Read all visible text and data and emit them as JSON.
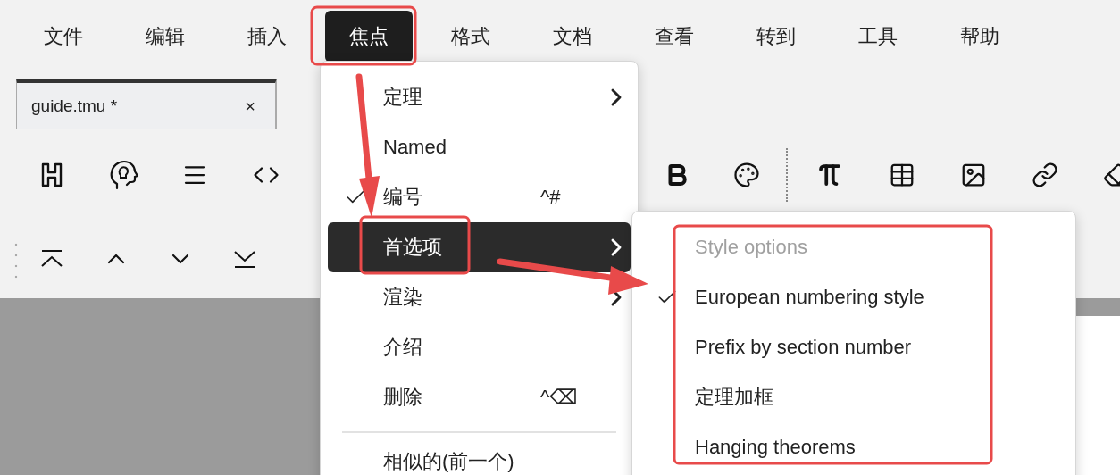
{
  "menubar": [
    {
      "label": "文件",
      "selected": false
    },
    {
      "label": "编辑",
      "selected": false
    },
    {
      "label": "插入",
      "selected": false
    },
    {
      "label": "焦点",
      "selected": true
    },
    {
      "label": "格式",
      "selected": false
    },
    {
      "label": "文档",
      "selected": false
    },
    {
      "label": "查看",
      "selected": false
    },
    {
      "label": "转到",
      "selected": false
    },
    {
      "label": "工具",
      "selected": false
    },
    {
      "label": "帮助",
      "selected": false
    }
  ],
  "tabs": [
    {
      "label": "guide.tmu *",
      "close": "×",
      "selected": true
    }
  ],
  "menu": {
    "items": [
      {
        "kind": "item",
        "label": "定理",
        "checked": false,
        "submenu": true,
        "selected": false
      },
      {
        "kind": "item",
        "label": "Named",
        "checked": false,
        "submenu": false,
        "selected": false
      },
      {
        "kind": "item",
        "label": "编号",
        "checked": true,
        "submenu": false,
        "selected": false,
        "shortcut": "^#"
      },
      {
        "kind": "item",
        "label": "首选项",
        "checked": false,
        "submenu": true,
        "selected": true
      },
      {
        "kind": "item",
        "label": "渲染",
        "checked": false,
        "submenu": true,
        "selected": false
      },
      {
        "kind": "item",
        "label": "介绍",
        "checked": false,
        "submenu": false,
        "selected": false
      },
      {
        "kind": "item",
        "label": "删除",
        "checked": false,
        "submenu": false,
        "selected": false,
        "shortcut": "^⌫"
      },
      {
        "kind": "separator"
      },
      {
        "kind": "item",
        "label": "相似的(前一个)",
        "checked": false,
        "submenu": false,
        "selected": false
      }
    ]
  },
  "submenu": {
    "header": "Style options",
    "items": [
      {
        "label": "European numbering style",
        "checked": true
      },
      {
        "label": "Prefix by section number",
        "checked": false
      },
      {
        "label": "定理加框",
        "checked": false
      },
      {
        "label": "Hanging theorems",
        "checked": false
      }
    ]
  }
}
